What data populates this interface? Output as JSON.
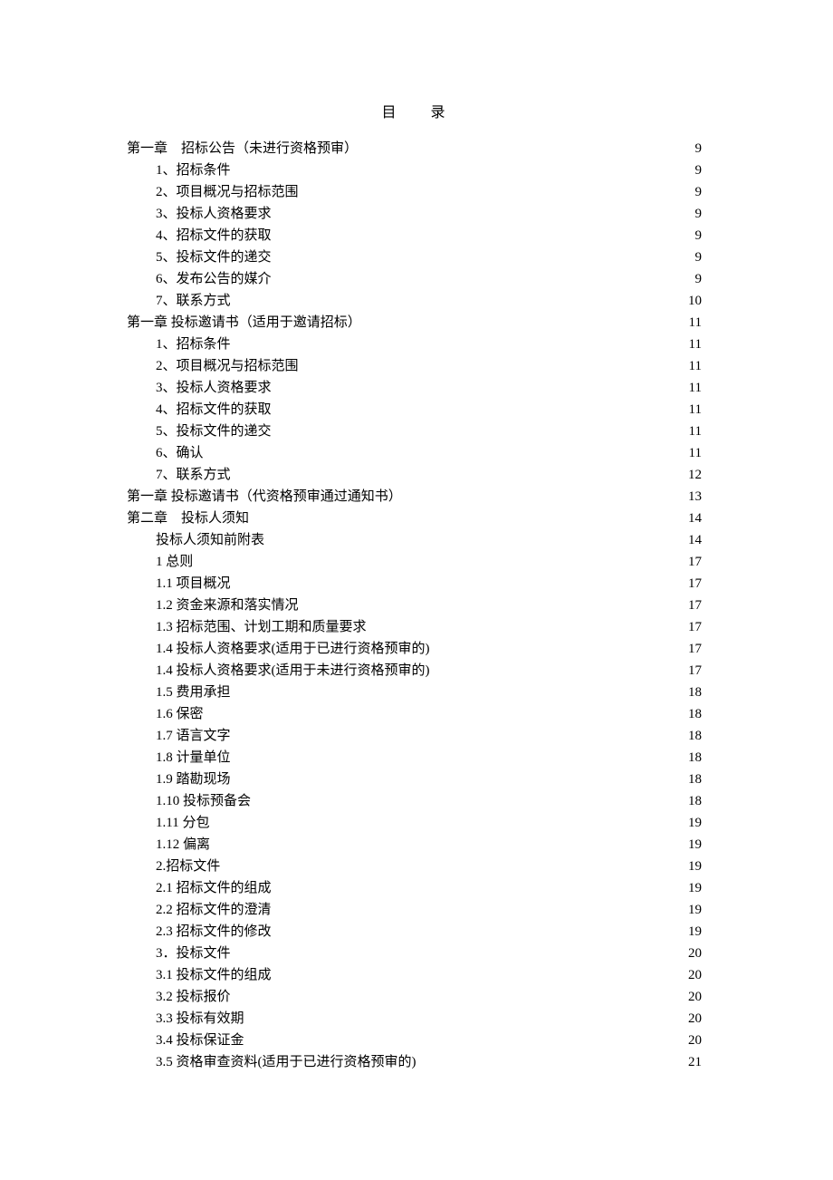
{
  "title_left": "目",
  "title_right": "录",
  "entries": [
    {
      "indent": 0,
      "label": "第一章 招标公告（未进行资格预审）",
      "page": "9"
    },
    {
      "indent": 1,
      "label": "1、招标条件",
      "page": "9"
    },
    {
      "indent": 1,
      "label": "2、项目概况与招标范围",
      "page": "9"
    },
    {
      "indent": 1,
      "label": "3、投标人资格要求",
      "page": "9"
    },
    {
      "indent": 1,
      "label": "4、招标文件的获取",
      "page": "9"
    },
    {
      "indent": 1,
      "label": "5、投标文件的递交",
      "page": "9"
    },
    {
      "indent": 1,
      "label": "6、发布公告的媒介",
      "page": "9"
    },
    {
      "indent": 1,
      "label": "7、联系方式",
      "page": "10"
    },
    {
      "indent": 0,
      "label": "第一章 投标邀请书（适用于邀请招标）",
      "page": "11"
    },
    {
      "indent": 1,
      "label": "1、招标条件",
      "page": "11"
    },
    {
      "indent": 1,
      "label": "2、项目概况与招标范围",
      "page": "11"
    },
    {
      "indent": 1,
      "label": "3、投标人资格要求",
      "page": "11"
    },
    {
      "indent": 1,
      "label": "4、招标文件的获取",
      "page": "11"
    },
    {
      "indent": 1,
      "label": "5、投标文件的递交",
      "page": "11"
    },
    {
      "indent": 1,
      "label": "6、确认",
      "page": "11"
    },
    {
      "indent": 1,
      "label": "7、联系方式",
      "page": "12"
    },
    {
      "indent": 0,
      "label": "第一章 投标邀请书（代资格预审通过通知书）",
      "page": "13"
    },
    {
      "indent": 0,
      "label": "第二章 投标人须知",
      "page": "14"
    },
    {
      "indent": 1,
      "label": "投标人须知前附表",
      "page": "14"
    },
    {
      "indent": 1,
      "label": "1 总则",
      "page": "17"
    },
    {
      "indent": 1,
      "label": "1.1 项目概况",
      "page": "17"
    },
    {
      "indent": 1,
      "label": "1.2 资金来源和落实情况",
      "page": "17"
    },
    {
      "indent": 1,
      "label": "1.3 招标范围、计划工期和质量要求",
      "page": "17"
    },
    {
      "indent": 1,
      "label": "1.4 投标人资格要求(适用于已进行资格预审的)",
      "page": "17"
    },
    {
      "indent": 1,
      "label": "1.4 投标人资格要求(适用于未进行资格预审的)",
      "page": "17"
    },
    {
      "indent": 1,
      "label": "1.5 费用承担",
      "page": "18"
    },
    {
      "indent": 1,
      "label": "1.6 保密",
      "page": "18"
    },
    {
      "indent": 1,
      "label": "1.7 语言文字",
      "page": "18"
    },
    {
      "indent": 1,
      "label": "1.8 计量单位",
      "page": "18"
    },
    {
      "indent": 1,
      "label": "1.9 踏勘现场",
      "page": "18"
    },
    {
      "indent": 1,
      "label": "1.10 投标预备会",
      "page": "18"
    },
    {
      "indent": 1,
      "label": "1.11 分包",
      "page": "19"
    },
    {
      "indent": 1,
      "label": "1.12 偏离",
      "page": "19"
    },
    {
      "indent": 1,
      "label": "2.招标文件",
      "page": "19"
    },
    {
      "indent": 1,
      "label": "2.1 招标文件的组成",
      "page": "19"
    },
    {
      "indent": 1,
      "label": "2.2 招标文件的澄清",
      "page": "19"
    },
    {
      "indent": 1,
      "label": "2.3 招标文件的修改",
      "page": "19"
    },
    {
      "indent": 1,
      "label": "3．投标文件",
      "page": "20"
    },
    {
      "indent": 1,
      "label": "3.1 投标文件的组成",
      "page": "20"
    },
    {
      "indent": 1,
      "label": "3.2 投标报价",
      "page": "20"
    },
    {
      "indent": 1,
      "label": "3.3 投标有效期",
      "page": "20"
    },
    {
      "indent": 1,
      "label": "3.4 投标保证金",
      "page": "20"
    },
    {
      "indent": 1,
      "label": "3.5 资格审查资料(适用于已进行资格预审的)",
      "page": "21"
    }
  ]
}
